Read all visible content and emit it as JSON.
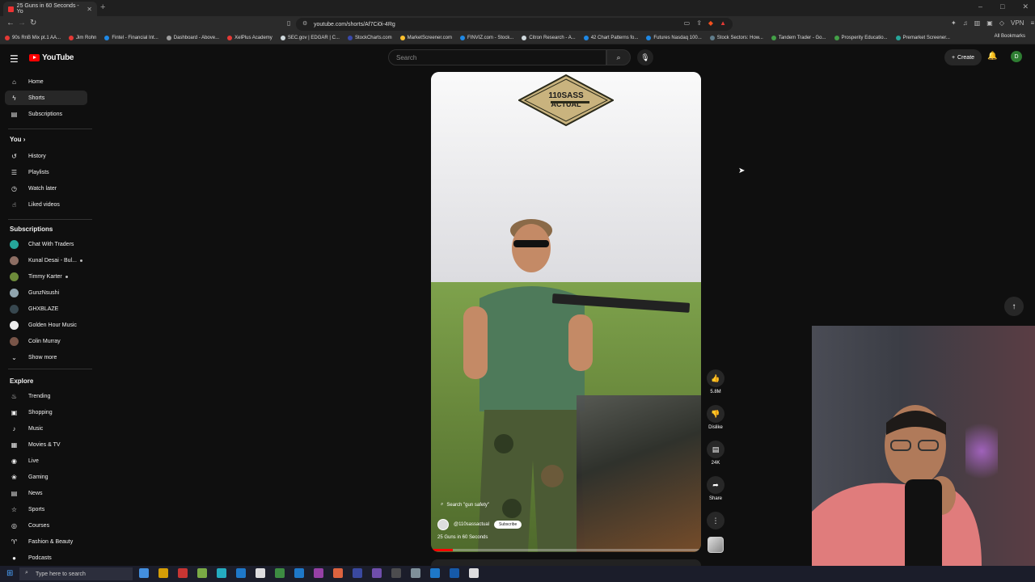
{
  "browser": {
    "tab_title": "25 Guns in 60 Seconds - Yo",
    "new_tab": "+",
    "window_controls": [
      "–",
      "□",
      "✕"
    ],
    "url": "youtube.com/shorts/Af7Ci0i-4Rg",
    "bookmarks": [
      {
        "label": "90s RnB Mix pt.1 AA...",
        "color": "#e53935"
      },
      {
        "label": "Jim Rohn",
        "color": "#e53935"
      },
      {
        "label": "Fintel - Financial Int...",
        "color": "#1e88e5"
      },
      {
        "label": "Dashboard - Above...",
        "color": "#9e9e9e"
      },
      {
        "label": "XelPlus Academy",
        "color": "#e53935"
      },
      {
        "label": "SEC.gov | EDGAR | C...",
        "color": "#cfd8dc"
      },
      {
        "label": "StockCharts.com",
        "color": "#3949ab"
      },
      {
        "label": "MarketScreener.com",
        "color": "#fbc02d"
      },
      {
        "label": "FINVIZ.com - Stock...",
        "color": "#1e88e5"
      },
      {
        "label": "Citron Research - A...",
        "color": "#cfd8dc"
      },
      {
        "label": "42 Chart Patterns fo...",
        "color": "#1e88e5"
      },
      {
        "label": "Futures Nasdaq 100...",
        "color": "#1e88e5"
      },
      {
        "label": "Stock Sectors: How...",
        "color": "#607d8b"
      },
      {
        "label": "Tandem Trader - Go...",
        "color": "#43a047"
      },
      {
        "label": "Prosperity Educatio...",
        "color": "#43a047"
      },
      {
        "label": "Premarket Screener...",
        "color": "#26a69a"
      }
    ],
    "all_bookmarks": "All Bookmarks",
    "vpn": "VPN"
  },
  "header": {
    "logo_text": "YouTube",
    "search_placeholder": "Search",
    "create_label": "Create",
    "avatar_letter": "D"
  },
  "sidebar": {
    "main": [
      {
        "label": "Home",
        "icon": "home-icon",
        "glyph": "⌂"
      },
      {
        "label": "Shorts",
        "icon": "shorts-icon",
        "glyph": "ϟ",
        "active": true
      },
      {
        "label": "Subscriptions",
        "icon": "subscriptions-icon",
        "glyph": "▤"
      }
    ],
    "you_header": "You",
    "you": [
      {
        "label": "History",
        "icon": "history-icon",
        "glyph": "↺"
      },
      {
        "label": "Playlists",
        "icon": "playlists-icon",
        "glyph": "☰"
      },
      {
        "label": "Watch later",
        "icon": "clock-icon",
        "glyph": "◷"
      },
      {
        "label": "Liked videos",
        "icon": "thumbs-up-icon",
        "glyph": "☝"
      }
    ],
    "subs_header": "Subscriptions",
    "subs": [
      {
        "label": "Chat With Traders",
        "color": "#26a69a"
      },
      {
        "label": "Kunal Desai - Bul...",
        "color": "#8d6e63",
        "live": true
      },
      {
        "label": "Timmy Karter",
        "color": "#6d8b3a",
        "live": true
      },
      {
        "label": "GunzNsushi",
        "color": "#90a4ae"
      },
      {
        "label": "GHXBLAZE",
        "color": "#37474f"
      },
      {
        "label": "Golden Hour Music",
        "color": "#eeeeee"
      },
      {
        "label": "Colin Murray",
        "color": "#795548"
      }
    ],
    "show_more": "Show more",
    "explore_header": "Explore",
    "explore": [
      {
        "label": "Trending",
        "icon": "trending-icon",
        "glyph": "♨"
      },
      {
        "label": "Shopping",
        "icon": "shopping-bag-icon",
        "glyph": "▣"
      },
      {
        "label": "Music",
        "icon": "music-icon",
        "glyph": "♪"
      },
      {
        "label": "Movies & TV",
        "icon": "film-icon",
        "glyph": "▦"
      },
      {
        "label": "Live",
        "icon": "live-icon",
        "glyph": "◉"
      },
      {
        "label": "Gaming",
        "icon": "gamepad-icon",
        "glyph": "❀"
      },
      {
        "label": "News",
        "icon": "news-icon",
        "glyph": "▤"
      },
      {
        "label": "Sports",
        "icon": "trophy-icon",
        "glyph": "☆"
      },
      {
        "label": "Courses",
        "icon": "courses-icon",
        "glyph": "◎"
      },
      {
        "label": "Fashion & Beauty",
        "icon": "hanger-icon",
        "glyph": "♈"
      },
      {
        "label": "Podcasts",
        "icon": "podcast-icon",
        "glyph": "●"
      }
    ]
  },
  "short": {
    "badge_line1": "110SASS",
    "badge_line2": "ACTUAL",
    "search_suggestion": "Search \"gun safety\"",
    "channel": "@110sassactual",
    "subscribe_label": "Subscribe",
    "title": "25 Guns in 60 Seconds",
    "progress": 0.08
  },
  "actions": {
    "likes": "5.8M",
    "dislike": "Dislike",
    "comments": "24K",
    "share": "Share"
  },
  "taskbar": {
    "search_placeholder": "Type here to search",
    "apps": [
      "#4aa3ff",
      "#f4b400",
      "#e53935",
      "#8bc34a",
      "#26c6da",
      "#1e88e5",
      "#ffffff",
      "#43a047",
      "#1e88e5",
      "#ab47bc",
      "#ff7043",
      "#3f51b5",
      "#7e57c2",
      "#555555",
      "#90a4ae",
      "#1e88e5",
      "#1565c0",
      "#ffffff"
    ]
  }
}
